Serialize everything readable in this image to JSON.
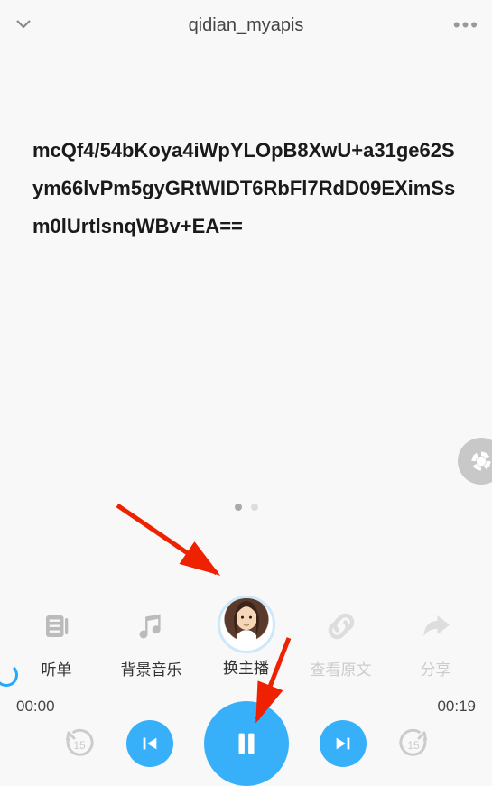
{
  "header": {
    "title": "qidian_myapis"
  },
  "content": {
    "text": "mcQf4/54bKoya4iWpYLOpB8XwU+a31ge62Sym66lvPm5gyGRtWIDT6RbFl7RdD09EXimSsm0lUrtlsnqWBv+EA=="
  },
  "tools": {
    "playlist": "听单",
    "bgm": "背景音乐",
    "anchor": "换主播",
    "original": "查看原文",
    "share": "分享"
  },
  "time": {
    "current": "00:00",
    "total": "00:19"
  },
  "seek": {
    "back": "15",
    "fwd": "15"
  }
}
